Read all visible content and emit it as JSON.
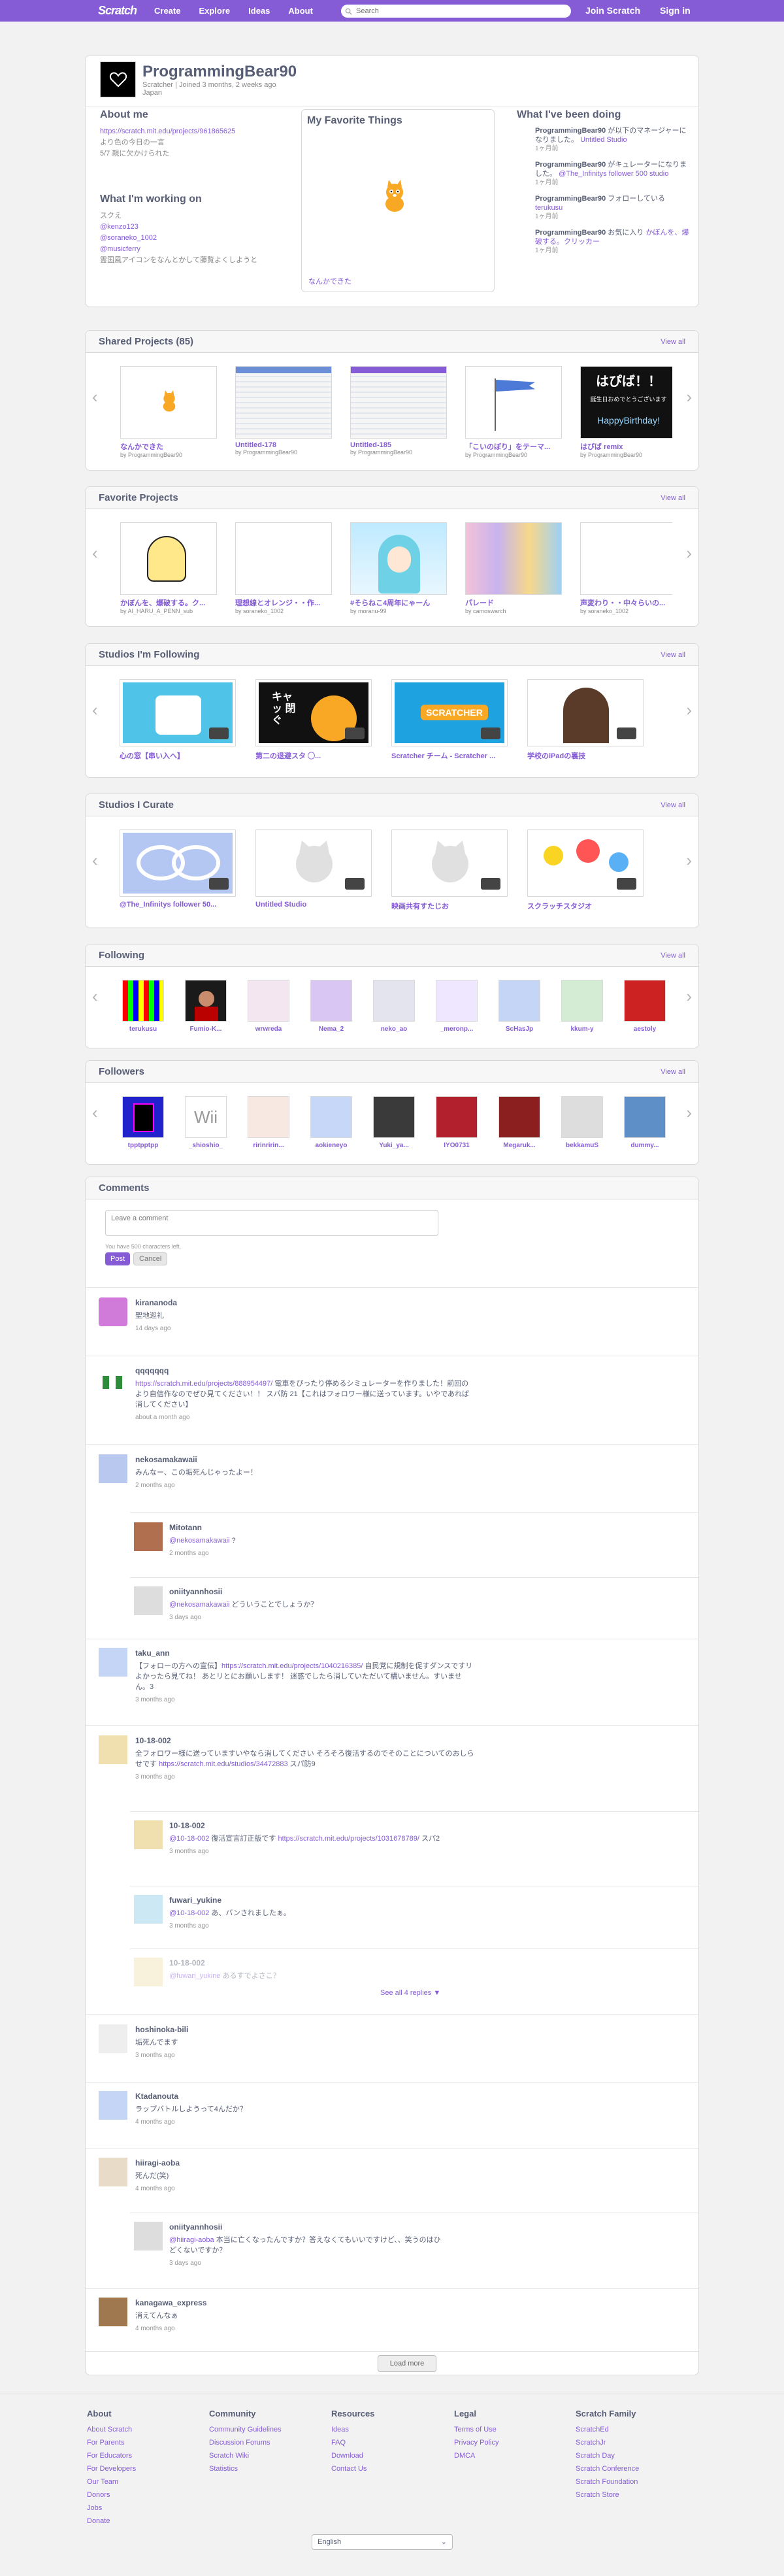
{
  "nav": {
    "items": [
      "Create",
      "Explore",
      "Ideas",
      "About"
    ],
    "search_placeholder": "Search",
    "join": "Join Scratch",
    "signin": "Sign in",
    "logo": "Scratch"
  },
  "profile": {
    "username": "ProgrammingBear90",
    "joined": "Scratcher  |  Joined 3 months, 2 weeks ago",
    "country": "Japan",
    "about_title": "About me",
    "about_link": "https://scratch.mit.edu/projects/961865625",
    "about_lines": [
      "より色の今日の一言",
      "5/7 親に欠かけられた"
    ],
    "working_title": "What I'm working on",
    "working_lines": [
      "スクえ",
      "@kenzo123",
      "@soraneko_1002",
      "@musicferry",
      "霊国風アイコンをなんとかして藤覧よくしようと"
    ],
    "favorite_title": "My Favorite Things",
    "favorite_caption": "なんかできた",
    "doing_title": "What I've been doing",
    "activity": [
      {
        "user": "ProgrammingBear90",
        "text": "が以下のマネージャーになりました。",
        "link": "Untitled Studio",
        "ago": "1ヶ月前"
      },
      {
        "user": "ProgrammingBear90",
        "text": "がキュレーターになりました。",
        "link": "@The_Infinitys follower 500 studio",
        "ago": "1ヶ月前"
      },
      {
        "user": "ProgrammingBear90",
        "text": "フォローしている",
        "link": "terukusu",
        "ago": "1ヶ月前"
      },
      {
        "user": "ProgrammingBear90",
        "text": "お気に入り",
        "link": "かぼんを、爆破する。クリッカー",
        "ago": "1ヶ月前"
      }
    ]
  },
  "shared": {
    "title": "Shared Projects (85)",
    "view_all": "View all",
    "items": [
      {
        "title": "なんかできた",
        "by": "by ProgrammingBear90"
      },
      {
        "title": "Untitled-178",
        "by": "by ProgrammingBear90"
      },
      {
        "title": "Untitled-185",
        "by": "by ProgrammingBear90"
      },
      {
        "title": "「こいのぼり」をテーマ...",
        "by": "by ProgrammingBear90"
      },
      {
        "title": "はぴば remix",
        "by": "by ProgrammingBear90"
      }
    ],
    "birthday_top": "はぴば！！",
    "birthday_mid": "誕生日おめでとうございます",
    "birthday_bottom": "HappyBirthday!"
  },
  "favorites": {
    "title": "Favorite Projects",
    "view_all": "View all",
    "items": [
      {
        "title": "かぼんを、爆破する。ク...",
        "by": "by AI_HARU_A_PENN_sub"
      },
      {
        "title": "理想線とオレンジ・・作...",
        "by": "by soraneko_1002"
      },
      {
        "title": "#そらねこ4周年にゃーん",
        "by": "by moranu-99"
      },
      {
        "title": "パレード",
        "by": "by camoswarch"
      },
      {
        "title": "声変わり・・中々らいの...",
        "by": "by soraneko_1002"
      }
    ]
  },
  "following_studios": {
    "title": "Studios I'm Following",
    "view_all": "View all",
    "items": [
      {
        "title": "心の窓【串い入へ】"
      },
      {
        "title": "第二の退避スタ ◯..."
      },
      {
        "title": "Scratcher チーム - Scratcher ..."
      },
      {
        "title": "学校のiPadの裏技"
      }
    ],
    "cat_text": "キャッ 閉ぐ",
    "scratcher_text": "SCRATCHER"
  },
  "curate_studios": {
    "title": "Studios I Curate",
    "view_all": "View all",
    "items": [
      {
        "title": "@The_Infinitys follower 50..."
      },
      {
        "title": "Untitled Studio"
      },
      {
        "title": "映画共有すたじお"
      },
      {
        "title": "スクラッチスタジオ"
      }
    ]
  },
  "following": {
    "title": "Following",
    "view_all": "View all",
    "users": [
      "terukusu",
      "Fumio-K...",
      "wrwreda",
      "Nema_2",
      "neko_ao",
      "_meronp...",
      "ScHasJp",
      "kkum-y",
      "aestoly"
    ]
  },
  "followers": {
    "title": "Followers",
    "view_all": "View all",
    "users": [
      "tpptpptpp",
      "_shioshio_",
      "ririnririn...",
      "aokieneyo",
      "Yuki_ya...",
      "IYO0731",
      "Megaruk...",
      "bekkamuS",
      "dummy..."
    ],
    "wii_text": "Wii"
  },
  "comments": {
    "title": "Comments",
    "placeholder": "Leave a comment",
    "hint": "You have 500 characters left.",
    "post": "Post",
    "cancel": "Cancel",
    "see_all": "See all 4 replies",
    "load_more": "Load more",
    "list": [
      {
        "user": "kirananoda",
        "text": "聖地巡礼",
        "ago": "14 days ago"
      },
      {
        "user": "qqqqqqq",
        "link": "https://scratch.mit.edu/projects/888954497/",
        "text": "電車をぴったり停めるシミュレーターを作りました！前回のより自信作なのでぜひ見てください！！ スパ防 21【これはフォロワー様に送っています。いやであれば消してください】",
        "ago": "about a month ago"
      },
      {
        "user": "nekosamakawaii",
        "text": "みんなー、この垢死んじゃったよー！",
        "ago": "2 months ago"
      },
      {
        "user": "Mitotann",
        "mention": "@nekosamakawaii",
        "text": " ?",
        "ago": "2 months ago"
      },
      {
        "user": "oniityannhosii",
        "mention": "@nekosamakawaii",
        "text": " どういうことでしょうか？",
        "ago": "3 days ago"
      },
      {
        "user": "taku_ann",
        "text_before": "【フォローの方への宣伝】",
        "link": "https://scratch.mit.edu/projects/1040216385/",
        "text": " 自民党に規制を促すダンスですリよかったら見てね！ あとリとにお願いします！ 迷惑でしたら消していただいて構いません。すいません。3",
        "ago": "3 months ago"
      },
      {
        "user": "10-18-002",
        "text": "全フォロワー様に送っていますいやなら消してください そろそろ復活するのでそのことについてのおしらせです ",
        "link": "https://scratch.mit.edu/studios/34472883",
        "text_after": " スパ防9",
        "ago": "3 months ago"
      },
      {
        "user": "10-18-002",
        "mention": "@10-18-002",
        "text": " 復活宣言訂正版です ",
        "link": "https://scratch.mit.edu/projects/1031678789/",
        "text_after": " スパ2",
        "ago": "3 months ago"
      },
      {
        "user": "fuwari_yukine",
        "mention": "@10-18-002",
        "text": " あ、バンされましたぁ。",
        "ago": "3 months ago"
      },
      {
        "user": "10-18-002",
        "mention": "@fuwari_yukine",
        "text": " あるすでよさこ？",
        "ago": ""
      },
      {
        "user": "hoshinoka-bili",
        "text": "垢死んでます",
        "ago": "3 months ago"
      },
      {
        "user": "Ktadanouta",
        "text": "ラップバトルしようって4んだか？",
        "ago": "4 months ago"
      },
      {
        "user": "hiiragi-aoba",
        "text": "死んだ(笑)",
        "ago": "4 months ago"
      },
      {
        "user": "oniityannhosii",
        "mention": "@hiiragi-aoba",
        "text": " 本当に亡くなったんですか？答えなくてもいいですけど、、笑うのはひどくないですか？",
        "ago": "3 days ago"
      },
      {
        "user": "kanagawa_express",
        "text": "消えてんなぁ",
        "ago": "4 months ago"
      }
    ]
  },
  "footer": {
    "cols": [
      {
        "title": "About",
        "links": [
          "About Scratch",
          "For Parents",
          "For Educators",
          "For Developers",
          "Our Team",
          "Donors",
          "Jobs",
          "Donate"
        ]
      },
      {
        "title": "Community",
        "links": [
          "Community Guidelines",
          "Discussion Forums",
          "Scratch Wiki",
          "Statistics"
        ]
      },
      {
        "title": "Resources",
        "links": [
          "Ideas",
          "FAQ",
          "Download",
          "Contact Us"
        ]
      },
      {
        "title": "Legal",
        "links": [
          "Terms of Use",
          "Privacy Policy",
          "DMCA"
        ]
      },
      {
        "title": "Scratch Family",
        "links": [
          "ScratchEd",
          "ScratchJr",
          "Scratch Day",
          "Scratch Conference",
          "Scratch Foundation",
          "Scratch Store"
        ]
      }
    ],
    "language": "English"
  },
  "colors": {
    "accent": "#855cd6",
    "text": "#575e75",
    "bg": "#f2f2f2"
  }
}
